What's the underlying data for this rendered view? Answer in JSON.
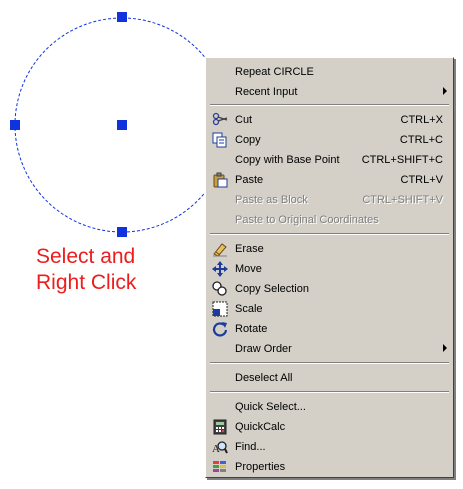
{
  "caption": {
    "line1": "Select and",
    "line2": "Right Click"
  },
  "menu": {
    "repeat": {
      "label": "Repeat CIRCLE"
    },
    "recent_input": {
      "label": "Recent Input"
    },
    "cut": {
      "label": "Cut",
      "shortcut": "CTRL+X",
      "icon": "scissors-icon"
    },
    "copy": {
      "label": "Copy",
      "shortcut": "CTRL+C",
      "icon": "copy-icon"
    },
    "copy_base": {
      "label": "Copy with Base Point",
      "shortcut": "CTRL+SHIFT+C"
    },
    "paste": {
      "label": "Paste",
      "shortcut": "CTRL+V",
      "icon": "paste-icon"
    },
    "paste_block": {
      "label": "Paste as Block",
      "shortcut": "CTRL+SHIFT+V"
    },
    "paste_orig": {
      "label": "Paste to Original Coordinates"
    },
    "erase": {
      "label": "Erase",
      "icon": "eraser-icon"
    },
    "move": {
      "label": "Move",
      "icon": "move-icon"
    },
    "copy_selection": {
      "label": "Copy Selection",
      "icon": "copy-selection-icon"
    },
    "scale": {
      "label": "Scale",
      "icon": "scale-icon"
    },
    "rotate": {
      "label": "Rotate",
      "icon": "rotate-icon"
    },
    "draw_order": {
      "label": "Draw Order"
    },
    "deselect_all": {
      "label": "Deselect All"
    },
    "quick_select": {
      "label": "Quick Select..."
    },
    "quickcalc": {
      "label": "QuickCalc",
      "icon": "calculator-icon"
    },
    "find": {
      "label": "Find...",
      "icon": "find-icon"
    },
    "properties": {
      "label": "Properties",
      "icon": "properties-icon"
    }
  },
  "colors": {
    "caption": "#ee1c1c",
    "grip": "#1133dd",
    "menu_bg": "#d4d0c8",
    "disabled": "#808080"
  }
}
